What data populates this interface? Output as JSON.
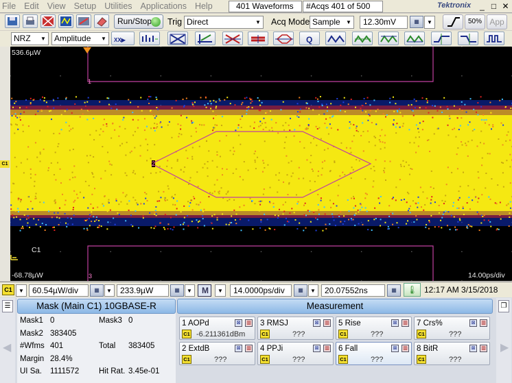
{
  "menu": {
    "items": [
      "File",
      "Edit",
      "View",
      "Setup",
      "Utilities",
      "Applications",
      "Help"
    ],
    "waveforms": "401 Waveforms",
    "acqs": "#Acqs  401 of 500",
    "brand": "Tektronix",
    "minimize": "_",
    "restore": "□",
    "close": "✕"
  },
  "toolbar": {
    "run_stop": "Run/Stop",
    "trig_label": "Trig",
    "trig_mode": "Direct",
    "acq_label": "Acq Mode",
    "acq_mode": "Sample",
    "threshold": "12.30mV",
    "pct_label": "50%",
    "app_label": "App",
    "signal_type": "NRZ",
    "display_mode": "Amplitude",
    "tool_icons": [
      "autoset-icon",
      "histogram-icon",
      "crosshair-icon",
      "eye-measure-icon",
      "cursor-icon",
      "mask-icon",
      "pattern-icon",
      "q-icon",
      "waveform1-icon",
      "waveform2-icon",
      "waveform3-icon",
      "waveform4-icon",
      "waveform5-icon",
      "waveform6-icon",
      "waveform7-icon"
    ]
  },
  "scope": {
    "top_value": "536.6µW",
    "bottom_value": "-68.78µW",
    "channel_label": "C1",
    "time_per_div": "14.00ps/div",
    "mask_region_1": "1",
    "mask_region_2": "2",
    "mask_region_3": "3",
    "left_marker": "C1",
    "colors": {
      "yellow": "#f5e812",
      "red": "#e02020",
      "blue": "#2040e0",
      "mask": "#c040a0"
    }
  },
  "status": {
    "channel": "C1",
    "vert_scale": "60.54µW/div",
    "offset": "233.9µW",
    "math": "M",
    "horiz_scale": "14.0000ps/div",
    "position": "20.07552ns",
    "datetime": "12:17 AM 3/15/2018"
  },
  "mask_panel": {
    "title": "Mask (Main  C1) 10GBASE-R",
    "rows": [
      {
        "l1": "Mask1",
        "v1": "0",
        "l2": "Mask3",
        "v2": "0"
      },
      {
        "l1": "Mask2",
        "v1": "383405",
        "l2": "",
        "v2": ""
      },
      {
        "l1": "#Wfms",
        "v1": "401",
        "l2": "Total",
        "v2": "383405"
      },
      {
        "l1": "Margin",
        "v1": "28.4%",
        "l2": "",
        "v2": ""
      },
      {
        "l1": "UI Sa.",
        "v1": "1111572",
        "l2": "Hit Rat.",
        "v2": "3.45e-01"
      }
    ]
  },
  "measurement": {
    "title": "Measurement",
    "cells": [
      {
        "name": "1 AOPd",
        "value": "-6.211361dBm",
        "badge": "C1"
      },
      {
        "name": "3 RMSJ",
        "value": "???",
        "badge": "C1"
      },
      {
        "name": "5 Rise",
        "value": "???",
        "badge": "C1"
      },
      {
        "name": "7 Crs%",
        "value": "???",
        "badge": "C1"
      },
      {
        "name": "2 ExtdB",
        "value": "???",
        "badge": "C1"
      },
      {
        "name": "4 PPJi",
        "value": "???",
        "badge": "C1"
      },
      {
        "name": "6 Fall",
        "value": "???",
        "badge": "C1"
      },
      {
        "name": "8 BitR",
        "value": "???",
        "badge": "C1"
      }
    ]
  }
}
